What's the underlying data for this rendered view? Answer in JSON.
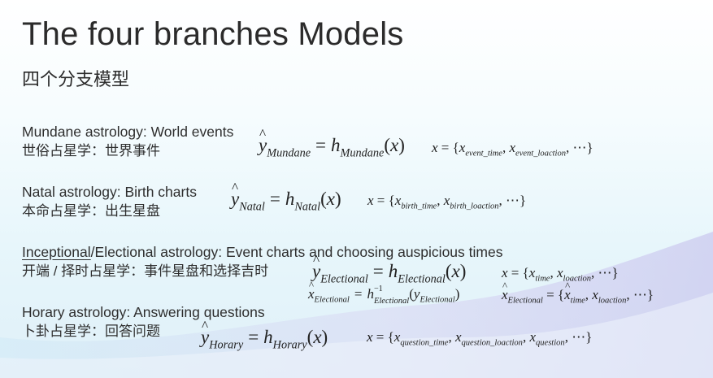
{
  "title": "The four branches Models",
  "subtitle": "四个分支模型",
  "sections": [
    {
      "en": "Mundane astrology: World events",
      "zh": "世俗占星学：世界事件",
      "subscript": "Mundane",
      "x_terms": [
        "event_time",
        "event_loaction"
      ]
    },
    {
      "en": "Natal astrology: Birth charts",
      "zh": "本命占星学：出生星盘",
      "subscript": "Natal",
      "x_terms": [
        "birth_time",
        "birth_loaction"
      ]
    },
    {
      "en_underlined": "Inceptional",
      "en_rest": "/Electional astrology: Event charts and choosing auspicious times",
      "zh": "开端 / 择时占星学：事件星盘和选择吉时",
      "subscript": "Electional",
      "x_terms": [
        "time",
        "loaction"
      ]
    },
    {
      "en": "Horary astrology: Answering questions",
      "zh": "卜卦占星学：回答问题",
      "subscript": "Horary",
      "x_terms": [
        "question_time",
        "question_loaction",
        "question"
      ]
    }
  ]
}
